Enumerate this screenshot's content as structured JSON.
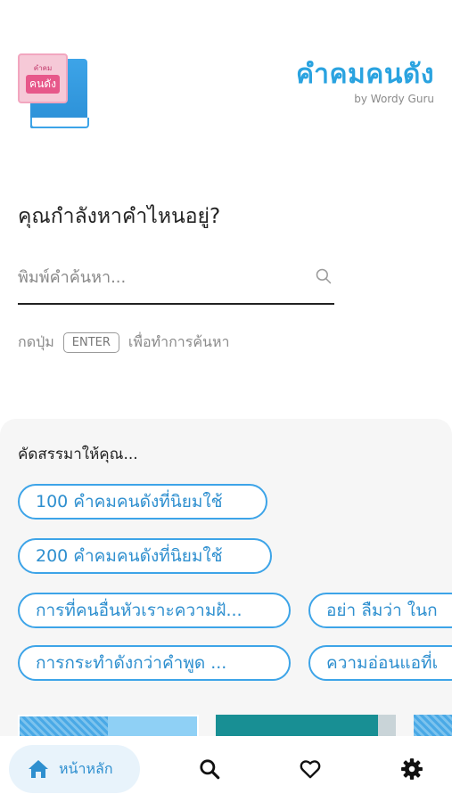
{
  "header": {
    "logo_text_top": "คำคม",
    "logo_text_bottom": "คนดัง",
    "title": "คำคมคนดัง",
    "subtitle": "by Wordy Guru"
  },
  "search": {
    "question": "คุณกำลังหาคำไหนอยู่?",
    "placeholder": "พิมพ์คำค้นหา...",
    "hint_prefix": "กดปุ่ม",
    "hint_key": "ENTER",
    "hint_suffix": "เพื่อทำการค้นหา"
  },
  "suggestions": {
    "title": "คัดสรรมาให้คุณ...",
    "chips": [
      "100 คำคมคนดังที่นิยมใช้",
      "200 คำคมคนดังที่นิยมใช้",
      "การที่คนอื่นหัวเราะความฝั...",
      "อย่า ลืมว่า ในก",
      "การกระทำดังกว่าคำพูด ...",
      "ความอ่อนแอที่เ"
    ]
  },
  "nav": {
    "home_label": "หน้าหลัก",
    "icons": [
      "home-icon",
      "search-icon",
      "heart-icon",
      "gear-icon"
    ]
  },
  "colors": {
    "accent": "#2aa3e0",
    "chip_border": "#3da4e8",
    "panel_bg": "#f6f6f6"
  }
}
